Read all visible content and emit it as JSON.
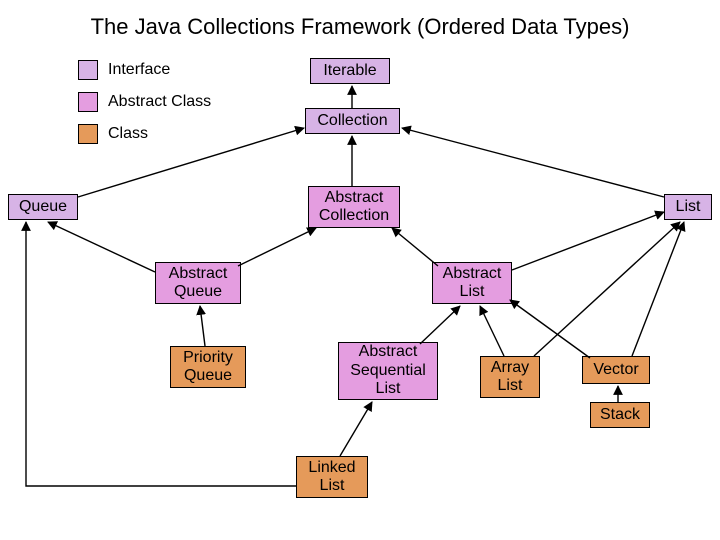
{
  "title": "The Java Collections Framework (Ordered Data Types)",
  "legend": {
    "interface": "Interface",
    "abstract": "Abstract Class",
    "class": "Class"
  },
  "nodes": {
    "iterable": "Iterable",
    "collection": "Collection",
    "queue": "Queue",
    "list": "List",
    "abstract_collection": "Abstract\nCollection",
    "abstract_queue": "Abstract\nQueue",
    "abstract_list": "Abstract\nList",
    "priority_queue": "Priority\nQueue",
    "abstract_sequential_list": "Abstract\nSequential\nList",
    "array_list": "Array\nList",
    "vector": "Vector",
    "stack": "Stack",
    "linked_list": "Linked\nList"
  },
  "colors": {
    "interface": "#d7b3e6",
    "abstract": "#e49de0",
    "class": "#e59a5a"
  },
  "chart_data": {
    "type": "diagram",
    "title": "The Java Collections Framework (Ordered Data Types)",
    "legend": [
      {
        "label": "Interface",
        "color": "#d7b3e6"
      },
      {
        "label": "Abstract Class",
        "color": "#e49de0"
      },
      {
        "label": "Class",
        "color": "#e59a5a"
      }
    ],
    "nodes": [
      {
        "id": "iterable",
        "label": "Iterable",
        "kind": "interface"
      },
      {
        "id": "collection",
        "label": "Collection",
        "kind": "interface"
      },
      {
        "id": "queue",
        "label": "Queue",
        "kind": "interface"
      },
      {
        "id": "list",
        "label": "List",
        "kind": "interface"
      },
      {
        "id": "abstract_collection",
        "label": "Abstract Collection",
        "kind": "abstract"
      },
      {
        "id": "abstract_queue",
        "label": "Abstract Queue",
        "kind": "abstract"
      },
      {
        "id": "abstract_list",
        "label": "Abstract List",
        "kind": "abstract"
      },
      {
        "id": "abstract_sequential_list",
        "label": "Abstract Sequential List",
        "kind": "abstract"
      },
      {
        "id": "priority_queue",
        "label": "Priority Queue",
        "kind": "class"
      },
      {
        "id": "array_list",
        "label": "Array List",
        "kind": "class"
      },
      {
        "id": "vector",
        "label": "Vector",
        "kind": "class"
      },
      {
        "id": "stack",
        "label": "Stack",
        "kind": "class"
      },
      {
        "id": "linked_list",
        "label": "Linked List",
        "kind": "class"
      }
    ],
    "edges": [
      {
        "from": "collection",
        "to": "iterable"
      },
      {
        "from": "queue",
        "to": "collection"
      },
      {
        "from": "list",
        "to": "collection"
      },
      {
        "from": "abstract_collection",
        "to": "collection"
      },
      {
        "from": "abstract_queue",
        "to": "queue"
      },
      {
        "from": "abstract_queue",
        "to": "abstract_collection"
      },
      {
        "from": "abstract_list",
        "to": "abstract_collection"
      },
      {
        "from": "abstract_list",
        "to": "list"
      },
      {
        "from": "priority_queue",
        "to": "abstract_queue"
      },
      {
        "from": "abstract_sequential_list",
        "to": "abstract_list"
      },
      {
        "from": "array_list",
        "to": "abstract_list"
      },
      {
        "from": "array_list",
        "to": "list"
      },
      {
        "from": "vector",
        "to": "abstract_list"
      },
      {
        "from": "vector",
        "to": "list"
      },
      {
        "from": "stack",
        "to": "vector"
      },
      {
        "from": "linked_list",
        "to": "abstract_sequential_list"
      },
      {
        "from": "linked_list",
        "to": "queue"
      }
    ]
  }
}
